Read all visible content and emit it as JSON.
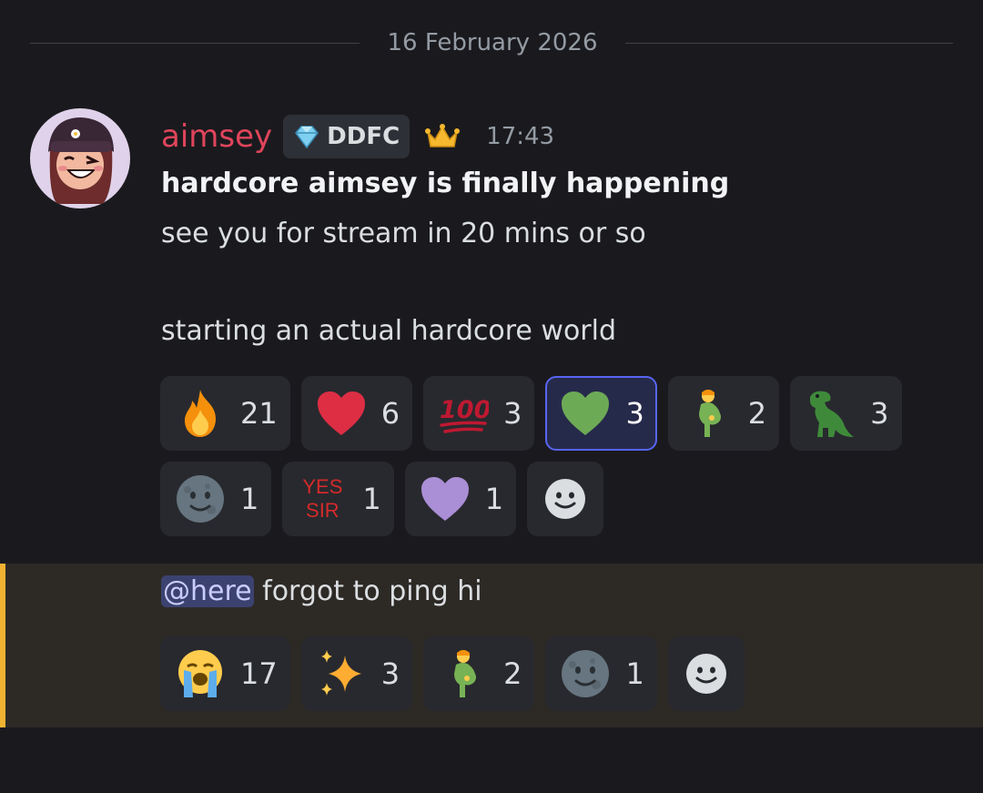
{
  "date_divider": "16 February 2026",
  "message": {
    "username": "aimsey",
    "tag": "DDFC",
    "timestamp": "17:43",
    "lines": [
      "hardcore aimsey is finally happening",
      "see you for stream in 20 mins or so",
      "starting an actual hardcore world"
    ],
    "reactions_row1": [
      {
        "emoji": "fire",
        "count": "21"
      },
      {
        "emoji": "red-heart",
        "count": "6"
      },
      {
        "emoji": "hundred-points",
        "count": "3"
      },
      {
        "emoji": "green-heart",
        "count": "3",
        "active": true
      },
      {
        "emoji": "pregnant-man",
        "count": "2"
      },
      {
        "emoji": "t-rex",
        "count": "3"
      }
    ],
    "reactions_row2": [
      {
        "emoji": "new-moon-face",
        "count": "1"
      },
      {
        "emoji": "yes-sir",
        "label_top": "YES",
        "label_bottom": "SIR",
        "count": "1"
      },
      {
        "emoji": "purple-heart",
        "count": "1"
      }
    ]
  },
  "followup": {
    "mention": "@here",
    "text": " forgot to ping hi",
    "reactions": [
      {
        "emoji": "loudly-crying-face",
        "count": "17"
      },
      {
        "emoji": "sparkles",
        "count": "3"
      },
      {
        "emoji": "pregnant-man",
        "count": "2"
      },
      {
        "emoji": "new-moon-face",
        "count": "1"
      }
    ]
  },
  "colors": {
    "background": "#1a1a1e",
    "username": "#e0455b",
    "active_reaction_border": "#5865f2",
    "mention_highlight_bar": "#f0b232"
  }
}
